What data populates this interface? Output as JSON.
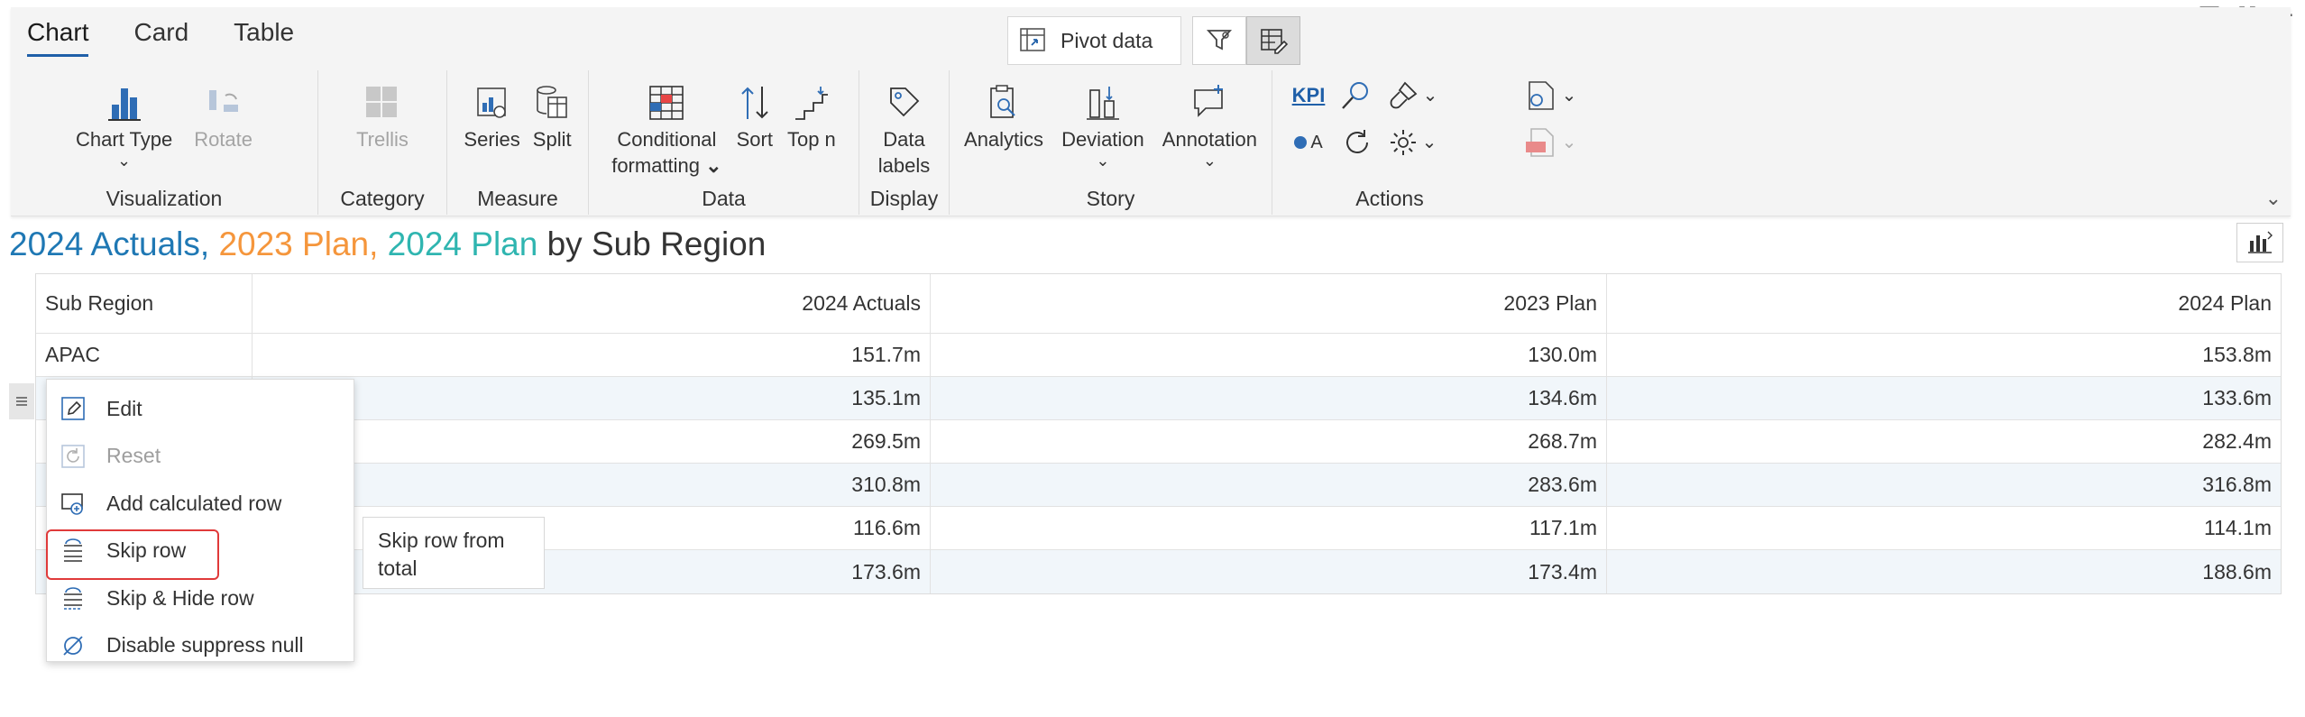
{
  "tabs": [
    {
      "label": "Chart",
      "active": true
    },
    {
      "label": "Card",
      "active": false
    },
    {
      "label": "Table",
      "active": false
    }
  ],
  "toolbar": {
    "pivot_label": "Pivot data"
  },
  "groups": {
    "visualization": {
      "title": "Visualization",
      "chart_type": "Chart Type",
      "rotate": "Rotate"
    },
    "category": {
      "title": "Category",
      "trellis": "Trellis"
    },
    "measure": {
      "title": "Measure",
      "series": "Series",
      "split": "Split"
    },
    "data": {
      "title": "Data",
      "cond1": "Conditional",
      "cond2": "formatting",
      "sort": "Sort",
      "topn": "Top n"
    },
    "display": {
      "title": "Display",
      "labels1": "Data",
      "labels2": "labels"
    },
    "story": {
      "title": "Story",
      "analytics": "Analytics",
      "deviation": "Deviation",
      "annotation": "Annotation"
    },
    "actions": {
      "title": "Actions",
      "kpi": "KPI",
      "a_label": "A"
    }
  },
  "title": {
    "part1": "2024 Actuals,",
    "part2": "2023 Plan,",
    "part3": "2024 Plan",
    "part4": "by Sub Region"
  },
  "table": {
    "headers": [
      "Sub Region",
      "2024 Actuals",
      "2023 Plan",
      "2024 Plan"
    ],
    "rows": [
      [
        "APAC",
        "151.7m",
        "130.0m",
        "153.8m"
      ],
      [
        "",
        "135.1m",
        "134.6m",
        "133.6m"
      ],
      [
        "",
        "269.5m",
        "268.7m",
        "282.4m"
      ],
      [
        "",
        "310.8m",
        "283.6m",
        "316.8m"
      ],
      [
        "",
        "116.6m",
        "117.1m",
        "114.1m"
      ],
      [
        "",
        "173.6m",
        "173.4m",
        "188.6m"
      ]
    ]
  },
  "context_menu": {
    "items": [
      {
        "label": "Edit",
        "icon": "pencil-icon",
        "enabled": true
      },
      {
        "label": "Reset",
        "icon": "reset-icon",
        "enabled": false
      },
      {
        "label": "Add calculated row",
        "icon": "add-row-icon",
        "enabled": true
      },
      {
        "label": "Skip row",
        "icon": "skip-row-icon",
        "enabled": true,
        "highlighted": true
      },
      {
        "label": "Skip & Hide row",
        "icon": "skip-hide-icon",
        "enabled": true
      },
      {
        "label": "Disable suppress null",
        "icon": "suppress-null-icon",
        "enabled": true
      }
    ]
  },
  "tooltip": {
    "line1": "Skip row from",
    "line2": "total"
  },
  "colors": {
    "actuals_2024": "#1f78b4",
    "plan_2023": "#f5963c",
    "plan_2024": "#2fb5b0",
    "accent": "#1f5fa8",
    "highlight_border": "#e03a3a"
  }
}
